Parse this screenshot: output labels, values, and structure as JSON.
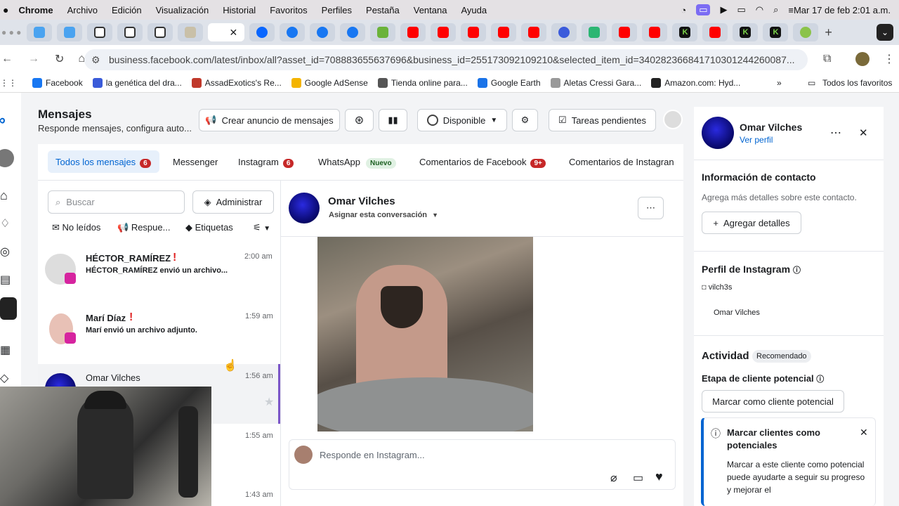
{
  "macos": {
    "app": "Chrome",
    "menus": [
      "Archivo",
      "Edición",
      "Visualización",
      "Historial",
      "Favoritos",
      "Perfiles",
      "Pestaña",
      "Ventana",
      "Ayuda"
    ],
    "datetime": "Mar 17 de feb  2:01 a.m."
  },
  "browser": {
    "url": "business.facebook.com/latest/inbox/all?asset_id=708883655637696&business_id=255173092109210&selected_item_id=340282366841710301244260087...",
    "bookmarks": [
      "Facebook",
      "la genética del dra...",
      "AssadExotics's Re...",
      "Google AdSense",
      "Tienda online para...",
      "Google Earth",
      "Aletas Cressi Gara...",
      "Amazon.com: Hyd..."
    ],
    "all_bookmarks": "Todos los favoritos"
  },
  "header": {
    "title": "Mensajes",
    "subtitle": "Responde mensajes, configura auto...",
    "create_ad": "Crear anuncio de mensajes",
    "status": "Disponible",
    "tasks": "Tareas pendientes"
  },
  "tabs": [
    {
      "label": "Todos los mensajes",
      "badge": "6"
    },
    {
      "label": "Messenger"
    },
    {
      "label": "Instagram",
      "badge": "6"
    },
    {
      "label": "WhatsApp",
      "tag": "Nuevo"
    },
    {
      "label": "Comentarios de Facebook",
      "badge": "9+"
    },
    {
      "label": "Comentarios de Instagran"
    }
  ],
  "search": {
    "placeholder": "Buscar",
    "manage": "Administrar"
  },
  "filters": {
    "unread": "No leídos",
    "responses": "Respue...",
    "labels": "Etiquetas"
  },
  "conversations": [
    {
      "name": "HÉCTOR_RAMÍREZ",
      "preview": "HÉCTOR_RAMÍREZ envió un archivo...",
      "time": "2:00 am"
    },
    {
      "name": "Marí Díaz",
      "preview": "Marí envió un archivo adjunto.",
      "time": "1:59 am"
    },
    {
      "name": "Omar Vilches",
      "preview": "",
      "time": "1:56 am"
    },
    {
      "name": "",
      "preview": "",
      "time": "1:55 am"
    },
    {
      "name": "",
      "preview": "",
      "time": "1:43 am"
    }
  ],
  "chat": {
    "name": "Omar Vilches",
    "assign": "Asignar esta conversación",
    "reply_placeholder": "Responde en Instagram..."
  },
  "contact": {
    "name": "Omar Vilches",
    "view_profile": "Ver perfil",
    "info_title": "Información de contacto",
    "info_text": "Agrega más detalles sobre este contacto.",
    "add_details": "Agregar detalles",
    "ig_title": "Perfil de Instagram",
    "ig_handle": "vilch3s",
    "ig_name": "Omar Vilches",
    "activity": "Actividad",
    "recommended": "Recomendado",
    "stage": "Etapa de cliente potencial",
    "mark_button": "Marcar como cliente potencial",
    "tip_title": "Marcar clientes como potenciales",
    "tip_text": "Marcar a este cliente como potencial puede ayudarte a seguir su progreso y mejorar el"
  },
  "colors": {
    "accent": "#0064d1",
    "badge": "#c62828",
    "selected_tab_bg": "#e7f0fb",
    "conv_selected": "#7b55c8"
  }
}
